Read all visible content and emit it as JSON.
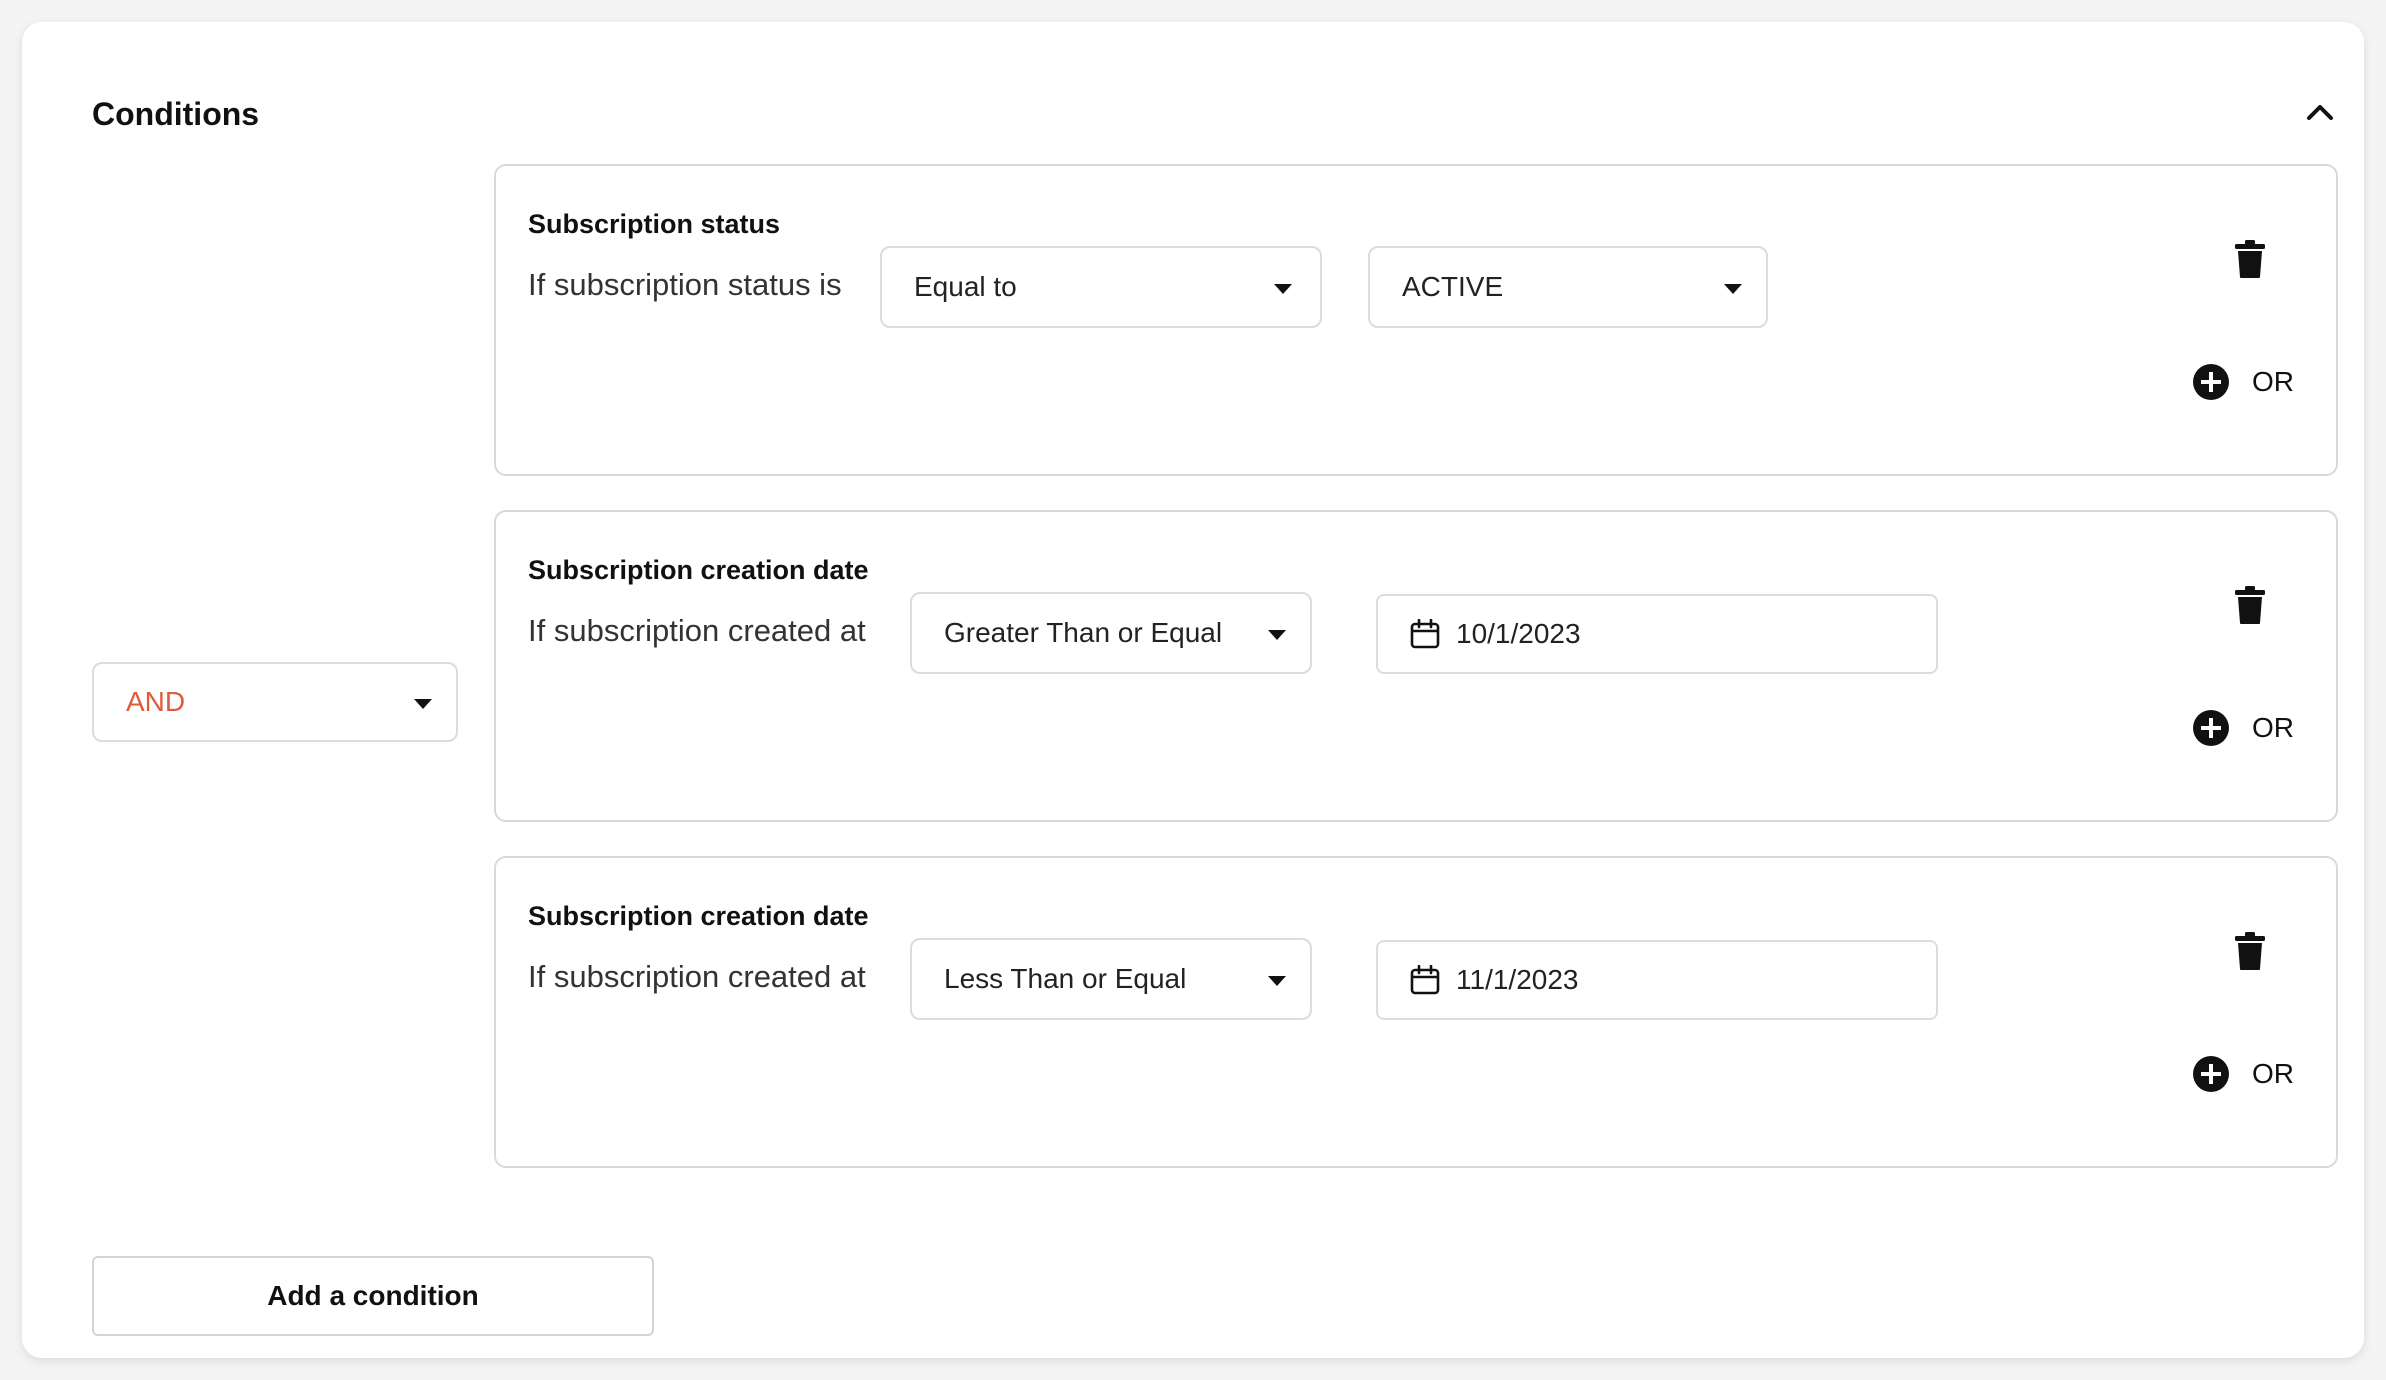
{
  "header": {
    "title": "Conditions"
  },
  "logic_operator": {
    "value": "AND",
    "color": "#e15a3c"
  },
  "conditions": [
    {
      "title": "Subscription status",
      "label": "If subscription status is",
      "operator": "Equal to",
      "value": "ACTIVE",
      "value_type": "select",
      "or_label": "OR"
    },
    {
      "title": "Subscription creation date",
      "label": "If subscription created at",
      "operator": "Greater Than or Equal",
      "value": "10/1/2023",
      "value_type": "date",
      "or_label": "OR"
    },
    {
      "title": "Subscription creation date",
      "label": "If subscription created at",
      "operator": "Less Than or Equal",
      "value": "11/1/2023",
      "value_type": "date",
      "or_label": "OR"
    }
  ],
  "add_condition_label": "Add a condition",
  "icons": {
    "collapse": "chevron-up-icon",
    "delete": "trash-icon",
    "add_or": "plus-circle-icon",
    "date": "calendar-icon",
    "dropdown": "caret-down-icon"
  }
}
